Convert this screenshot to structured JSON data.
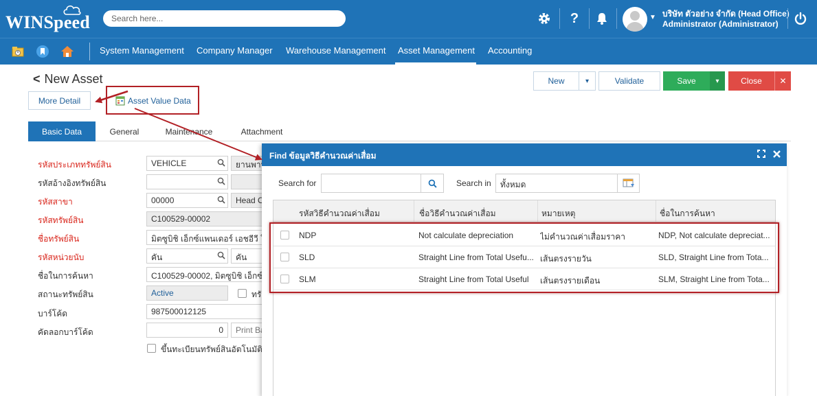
{
  "header": {
    "logo": "WINSpeed",
    "search_placeholder": "Search here...",
    "icons": [
      "gear-icon",
      "help-icon",
      "bell-icon",
      "avatar",
      "power-icon"
    ],
    "user_company": "บริษัท ตัวอย่าง จำกัด (Head Office)",
    "user_name": "Administrator (Administrator)"
  },
  "menu": {
    "quick_icons": [
      "folder-clock-icon",
      "bookmark-icon",
      "home-icon"
    ],
    "items": [
      "System Management",
      "Company Manager",
      "Warehouse Management",
      "Asset Management",
      "Accounting"
    ],
    "active": "Asset Management"
  },
  "page": {
    "back_symbol": "<",
    "title": "New Asset",
    "more_detail": "More Detail",
    "asset_value_data": "Asset Value Data",
    "buttons": {
      "new": "New",
      "validate": "Validate",
      "save": "Save",
      "close": "Close",
      "dropdown_symbol": "▾",
      "close_x": "✕"
    }
  },
  "tabs": [
    "Basic Data",
    "General",
    "Maintenance",
    "Attachment"
  ],
  "form": {
    "labels": [
      "รหัสประเภททรัพย์สิน",
      "รหัสอ้างอิงทรัพย์สิน",
      "รหัสสาขา",
      "รหัสทรัพย์สิน",
      "ชื่อทรัพย์สิน",
      "รหัสหน่วยนับ",
      "ชื่อในการค้นหา",
      "สถานะทรัพย์สิน",
      "บาร์โค้ด",
      "คัดลอกบาร์โค้ด"
    ],
    "asset_type_code": "VEHICLE",
    "asset_type_name": "ยานพาหนะ",
    "asset_ref_code": "",
    "branch_code": "00000",
    "branch_name": "Head Office",
    "asset_code": "C100529-00002",
    "asset_name": "มิตซูบิชิ เอ็กซ์แพนเดอร์ เอชอีวี ใหม่",
    "unit_code": "คัน",
    "unit_name": "คัน",
    "search_name": "C100529-00002, มิตซูบิชิ เอ็กซ์แพนเดอร์",
    "status": "Active",
    "status_check_label": "ทรัพย์สินไม่มีตัวตน",
    "barcode": "987500012125",
    "copy_barcode_count": "0",
    "print_barcode": "Print Barcode",
    "auto_register_label": "ขึ้นทะเบียนทรัพย์สินอัตโนมัติ"
  },
  "dialog": {
    "title": "Find ข้อมูลวิธีคำนวณค่าเสื่อม",
    "search_for_label": "Search for",
    "search_for_value": "",
    "search_in_label": "Search in",
    "search_in_value": "ทั้งหมด",
    "columns": [
      "รหัสวิธีคำนวณค่าเสื่อม",
      "ชื่อวิธีคำนวณค่าเสื่อม",
      "หมายเหตุ",
      "ชื่อในการค้นหา"
    ],
    "rows": [
      {
        "code": "NDP",
        "name": "Not calculate depreciation",
        "note": "ไม่คำนวณค่าเสื่อมราคา",
        "search": "NDP, Not calculate depreciat..."
      },
      {
        "code": "SLD",
        "name": "Straight Line from Total Usefu...",
        "note": "เส้นตรงรายวัน",
        "search": "SLD, Straight Line from Tota..."
      },
      {
        "code": "SLM",
        "name": "Straight Line from Total Useful",
        "note": "เส้นตรงรายเดือน",
        "search": "SLM, Straight Line from Tota..."
      }
    ]
  },
  "colors": {
    "brand_blue": "#1f73b7",
    "save_green": "#2eac5a",
    "close_red": "#e04b45",
    "highlight_red": "#b22025",
    "required_label": "#d9261c"
  }
}
